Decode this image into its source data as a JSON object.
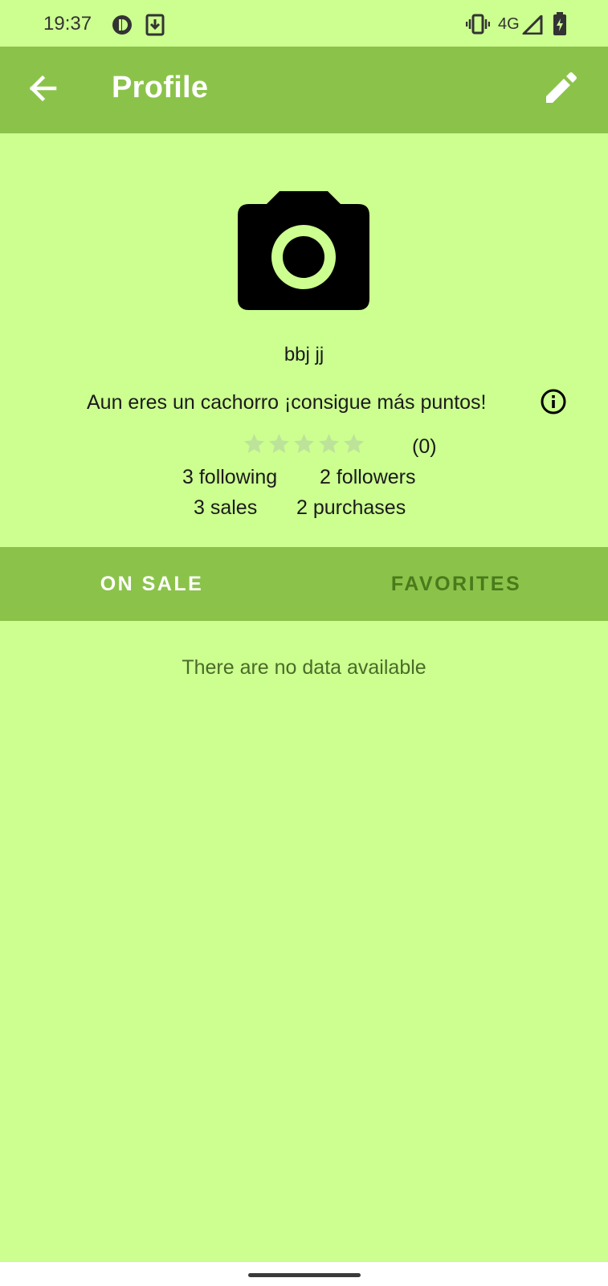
{
  "status_bar": {
    "time": "19:37",
    "network": "4G",
    "icons": [
      "app-notification-icon",
      "download-icon",
      "vibrate-icon",
      "signal-icon",
      "battery-charging-icon"
    ]
  },
  "app_bar": {
    "title": "Profile",
    "back_icon": "arrow-back-icon",
    "edit_icon": "pencil-icon",
    "color": "#8bc34a"
  },
  "profile": {
    "avatar_icon": "camera-icon",
    "name": "bbj jj",
    "level_text": "Aun eres un cachorro ¡consigue más puntos!",
    "info_icon": "info-icon",
    "rating": {
      "stars": 0,
      "max_stars": 5,
      "count_label": "(0)"
    },
    "stats": {
      "following": "3 following",
      "followers": "2 followers",
      "sales": "3 sales",
      "purchases": "2 purchases"
    }
  },
  "tabs": [
    {
      "label": "ON SALE",
      "selected": true
    },
    {
      "label": "FAVORITES",
      "selected": false
    }
  ],
  "content": {
    "empty_message": "There are no data available"
  },
  "colors": {
    "background": "#ccff90",
    "primary": "#8bc34a",
    "star_empty": "#bde39a"
  }
}
